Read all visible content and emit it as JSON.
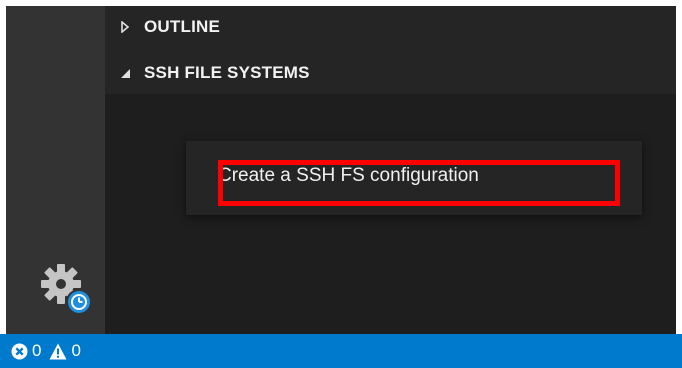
{
  "sidebar": {
    "sections": [
      {
        "label": "OUTLINE",
        "expanded": false,
        "chevron_icon": "chevron-right-icon"
      },
      {
        "label": "SSH FILE SYSTEMS",
        "expanded": true,
        "chevron_icon": "chevron-down-icon"
      }
    ]
  },
  "context_menu": {
    "items": [
      {
        "label": "Create a SSH FS configuration",
        "highlighted": true
      }
    ]
  },
  "activity_bar": {
    "manage_icon": "gear-with-clock-icon"
  },
  "status_bar": {
    "errors_icon": "error-circle-icon",
    "errors_count": "0",
    "warnings_icon": "warning-triangle-icon",
    "warnings_count": "0"
  },
  "colors": {
    "activity_bar": "#333333",
    "sidebar_header": "#252526",
    "sidebar_body": "#1e1e1e",
    "status_bar": "#007acc",
    "highlight": "#ff0000"
  }
}
